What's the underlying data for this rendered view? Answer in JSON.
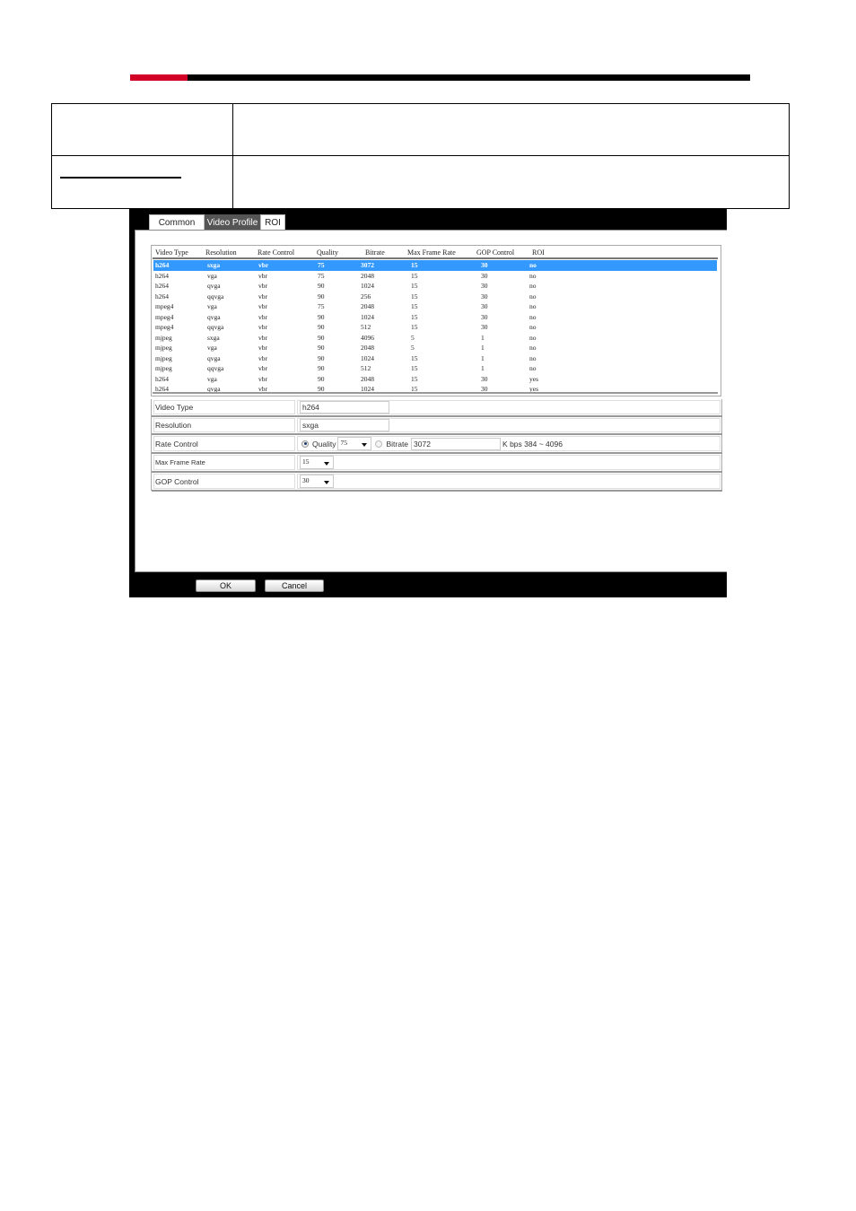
{
  "header": {
    "accent_color": "#d20024",
    "bar_color": "#000000"
  },
  "tabs": [
    {
      "label": "Common",
      "active": false
    },
    {
      "label": "Video Profile",
      "active": true
    },
    {
      "label": "ROI",
      "active": false
    }
  ],
  "profile_list": {
    "columns": [
      "Video Type",
      "Resolution",
      "Rate Control",
      "Quality",
      "Bitrate",
      "Max Frame Rate",
      "GOP Control",
      "ROI"
    ],
    "selected_index": 0,
    "selection_color": "#3399ff",
    "rows": [
      [
        "h264",
        "sxga",
        "vbr",
        "75",
        "3072",
        "15",
        "30",
        "no"
      ],
      [
        "h264",
        "vga",
        "vbr",
        "75",
        "2048",
        "15",
        "30",
        "no"
      ],
      [
        "h264",
        "qvga",
        "vbr",
        "90",
        "1024",
        "15",
        "30",
        "no"
      ],
      [
        "h264",
        "qqvga",
        "vbr",
        "90",
        "256",
        "15",
        "30",
        "no"
      ],
      [
        "mpeg4",
        "vga",
        "vbr",
        "75",
        "2048",
        "15",
        "30",
        "no"
      ],
      [
        "mpeg4",
        "qvga",
        "vbr",
        "90",
        "1024",
        "15",
        "30",
        "no"
      ],
      [
        "mpeg4",
        "qqvga",
        "vbr",
        "90",
        "512",
        "15",
        "30",
        "no"
      ],
      [
        "mjpeg",
        "sxga",
        "vbr",
        "90",
        "4096",
        "5",
        "1",
        "no"
      ],
      [
        "mjpeg",
        "vga",
        "vbr",
        "90",
        "2048",
        "5",
        "1",
        "no"
      ],
      [
        "mjpeg",
        "qvga",
        "vbr",
        "90",
        "1024",
        "15",
        "1",
        "no"
      ],
      [
        "mjpeg",
        "qqvga",
        "vbr",
        "90",
        "512",
        "15",
        "1",
        "no"
      ],
      [
        "h264",
        "vga",
        "vbr",
        "90",
        "2048",
        "15",
        "30",
        "yes"
      ],
      [
        "h264",
        "qvga",
        "vbr",
        "90",
        "1024",
        "15",
        "30",
        "yes"
      ]
    ]
  },
  "form": {
    "video_type": {
      "label": "Video Type",
      "value": "h264"
    },
    "resolution": {
      "label": "Resolution",
      "value": "sxga"
    },
    "rate_control": {
      "label": "Rate Control",
      "quality_label": "Quality",
      "quality_value": "75",
      "quality_selected": true,
      "bitrate_label": "Bitrate",
      "bitrate_value": "3072",
      "bitrate_range": "K bps 384 ~ 4096"
    },
    "max_frame_rate": {
      "label": "Max Frame Rate",
      "value": "15"
    },
    "gop_control": {
      "label": "GOP Control",
      "value": "30"
    }
  },
  "buttons": {
    "ok": "OK",
    "cancel": "Cancel"
  }
}
